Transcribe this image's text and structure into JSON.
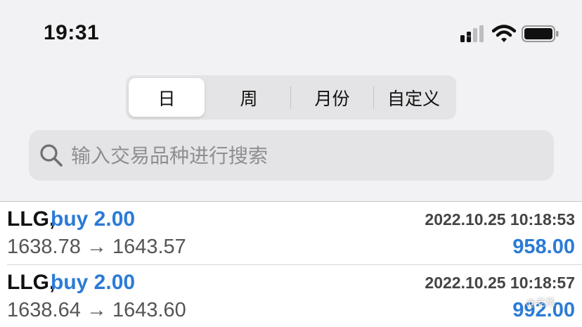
{
  "status_bar": {
    "time": "19:31",
    "icons": [
      "signal-icon",
      "wifi-icon",
      "battery-icon"
    ]
  },
  "period_tabs": {
    "items": [
      {
        "label": "日",
        "active": true
      },
      {
        "label": "周",
        "active": false
      },
      {
        "label": "月份",
        "active": false
      },
      {
        "label": "自定义",
        "active": false
      }
    ]
  },
  "search": {
    "placeholder": "输入交易品种进行搜索",
    "value": ""
  },
  "trades": [
    {
      "symbol": "LLG,",
      "side": "buy 2.00",
      "timestamp": "2022.10.25 10:18:53",
      "prices": "1638.78 → 1643.57",
      "profit": "958.00"
    },
    {
      "symbol": "LLG,",
      "side": "buy 2.00",
      "timestamp": "2022.10.25 10:18:57",
      "prices": "1638.64 → 1643.60",
      "profit": "992.00"
    }
  ],
  "watermark": "@老杨",
  "colors": {
    "accent": "#2b7bd6",
    "background": "#f2f2f4",
    "control": "#e4e4e6"
  }
}
